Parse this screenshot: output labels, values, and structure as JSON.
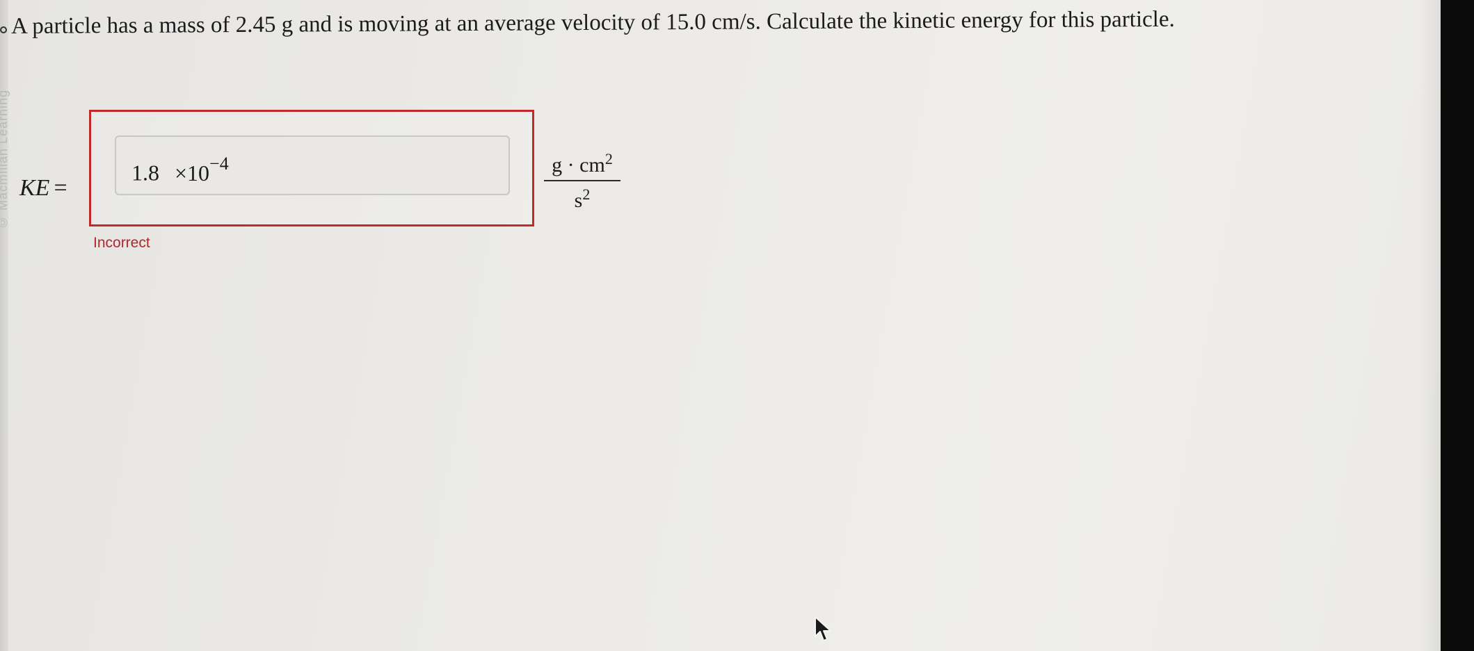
{
  "question": {
    "text": "A particle has a mass of 2.45 g and is moving at an average velocity of 15.0 cm/s. Calculate the kinetic energy for this particle."
  },
  "answer": {
    "variable_label": "KE",
    "equals_sign": "=",
    "mantissa": "1.8",
    "times_base": "×10",
    "exponent": "−4",
    "unit_numerator": "g · cm",
    "unit_numerator_power": "2",
    "unit_denominator": "s",
    "unit_denominator_power": "2"
  },
  "feedback": {
    "status": "Incorrect",
    "status_color": "#b3262a"
  },
  "side_watermark": "© Macmillan Learning",
  "icons": {
    "cursor": "mouse-pointer-icon",
    "question_marker": "question-marker-icon"
  }
}
